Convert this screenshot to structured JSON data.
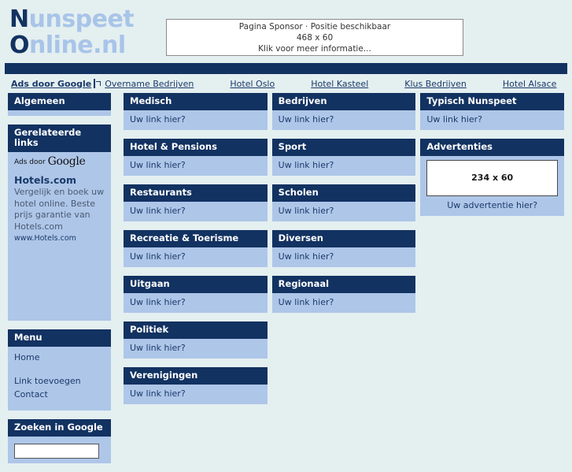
{
  "site": {
    "logo_line1_cap": "N",
    "logo_line1_rest": "unspeet",
    "logo_line2_cap": "O",
    "logo_line2_rest": "nline.nl"
  },
  "sponsor_banner": {
    "line1": "Pagina Sponsor · Positie beschikbaar",
    "line2": "468 x 60",
    "line3": "Klik voor meer informatie..."
  },
  "adsense_strip": {
    "label": "Ads door Google",
    "icon": "external-link-icon",
    "links": [
      "Overname Bedrijven",
      "Hotel Oslo",
      "Hotel Kasteel",
      "Klus Bedrijven",
      "Hotel Alsace"
    ]
  },
  "sidebar": {
    "algemeen": {
      "title": "Algemeen"
    },
    "related": {
      "title": "Gerelateerde links",
      "ads_by": "Ads door ",
      "ads_by_brand": "Google",
      "ad_title": "Hotels.com",
      "ad_text": "Vergelijk en boek uw hotel online. Beste prijs garantie van Hotels.com",
      "ad_url": "www.Hotels.com"
    },
    "menu": {
      "title": "Menu",
      "items": [
        "Home",
        "Link toevoegen",
        "Contact"
      ]
    },
    "search": {
      "title": "Zoeken in Google",
      "value": "",
      "placeholder": ""
    }
  },
  "link_placeholder": "Uw link hier?",
  "columns": [
    {
      "categories": [
        {
          "title": "Medisch"
        },
        {
          "title": "Hotel & Pensions"
        },
        {
          "title": "Restaurants"
        },
        {
          "title": "Recreatie & Toerisme"
        },
        {
          "title": "Uitgaan"
        },
        {
          "title": "Politiek"
        },
        {
          "title": "Verenigingen"
        }
      ]
    },
    {
      "categories": [
        {
          "title": "Bedrijven"
        },
        {
          "title": "Sport"
        },
        {
          "title": "Scholen"
        },
        {
          "title": "Diversen"
        },
        {
          "title": "Regionaal"
        }
      ]
    },
    {
      "categories": [
        {
          "title": "Typisch Nunspeet"
        }
      ],
      "advert": {
        "title": "Advertenties",
        "box_label": "234 x 60",
        "caption": "Uw advertentie hier?"
      }
    }
  ],
  "colors": {
    "navy": "#123261",
    "panel_body": "#aec6e8",
    "page_bg": "#e4eff0",
    "logo_light": "#a8c4e8"
  }
}
